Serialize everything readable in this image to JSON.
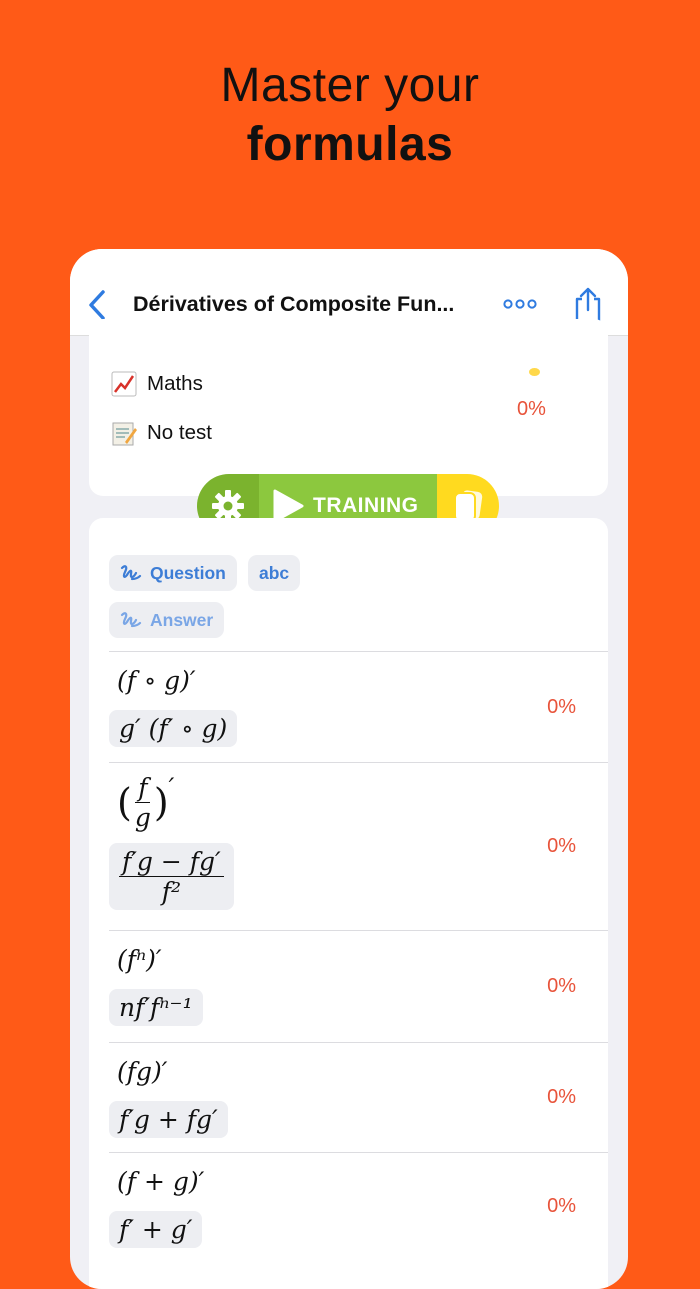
{
  "headline": {
    "line1": "Master your",
    "line2": "formulas"
  },
  "navbar": {
    "title": "Dérivatives of Composite Fun...",
    "back_icon": "chevron-left-icon",
    "more_icon": "ellipsis-icon",
    "share_icon": "share-icon"
  },
  "info": {
    "subject": "Maths",
    "subject_emoji": "chart-increasing-emoji",
    "test": "No test",
    "test_emoji": "memo-emoji",
    "progress": "0%"
  },
  "training": {
    "label": "TRAINING",
    "settings_icon": "gear-icon",
    "play_icon": "play-icon",
    "cards_icon": "flashcards-icon"
  },
  "chips": {
    "question": "Question",
    "abc": "abc",
    "answer": "Answer"
  },
  "formulas": [
    {
      "question": "(f ∘ g)′",
      "answer": "g′ (f′ ∘ g)",
      "percent": "0%"
    },
    {
      "question_num": "f",
      "question_den": "g",
      "answer_num": "f′g − fg′",
      "answer_den": "f²",
      "percent": "0%"
    },
    {
      "question": "(fⁿ)′",
      "answer": "nf′fⁿ⁻¹",
      "percent": "0%"
    },
    {
      "question": "(fg)′",
      "answer": "f′g + fg′",
      "percent": "0%"
    },
    {
      "question": "(f + g)′",
      "answer": "f′ + g′",
      "percent": "0%"
    }
  ],
  "colors": {
    "background": "#FF5A17",
    "accent": "#3D7DD6",
    "percent": "#E8533A",
    "training_green": "#8CC83E",
    "training_yellow": "#FFDA1F"
  }
}
